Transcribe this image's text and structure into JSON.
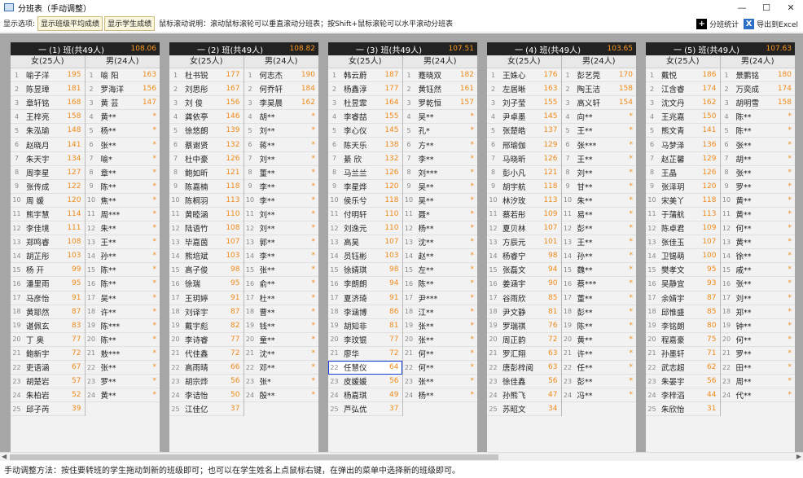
{
  "window": {
    "title": "分班表（手动调整）",
    "min": "—",
    "max": "☐",
    "close": "✕"
  },
  "toolbar": {
    "label": "显示选项:",
    "btn_avg": "显示班级平均成绩",
    "btn_score": "显示学生成绩",
    "note": "鼠标滚动说明：滚动鼠标滚轮可以垂直滚动分班表；按Shift+鼠标滚轮可以水平滚动分班表",
    "stats": "分班统计",
    "export": "导出到Excel"
  },
  "status": "手动调整方法：按住要转班的学生拖动到新的班级即可；也可以在学生姓名上点鼠标右键，在弹出的菜单中选择新的班级即可。",
  "classes": [
    {
      "title": "一 (1) 班(共49人)",
      "avg": "108.06",
      "female_hdr": "女(25人)",
      "male_hdr": "男(24人)",
      "female": [
        [
          "1",
          "喻子洋",
          "195"
        ],
        [
          "2",
          "陈昱璋",
          "181"
        ],
        [
          "3",
          "章轩铭",
          "168"
        ],
        [
          "4",
          "王梓亮",
          "158"
        ],
        [
          "5",
          "朱泓瑜",
          "148"
        ],
        [
          "6",
          "赵晓月",
          "141"
        ],
        [
          "7",
          "朱天宇",
          "134"
        ],
        [
          "8",
          "周李星",
          "127"
        ],
        [
          "9",
          "张传成",
          "122"
        ],
        [
          "10",
          "周 媛",
          "120"
        ],
        [
          "11",
          "熊宇慧",
          "114"
        ],
        [
          "12",
          "李佳境",
          "111"
        ],
        [
          "13",
          "郑鸣睿",
          "108"
        ],
        [
          "14",
          "胡芷彤",
          "103"
        ],
        [
          "15",
          "杨 开",
          "99"
        ],
        [
          "16",
          "潘里雨",
          "95"
        ],
        [
          "17",
          "马彦怡",
          "91"
        ],
        [
          "18",
          "黄耶然",
          "87"
        ],
        [
          "19",
          "谌佩玄",
          "83"
        ],
        [
          "20",
          "丁 奥",
          "77"
        ],
        [
          "21",
          "鲍新宇",
          "72"
        ],
        [
          "22",
          "吏语涵",
          "67"
        ],
        [
          "23",
          "胡楚岩",
          "57"
        ],
        [
          "24",
          "朱柏岩",
          "52"
        ],
        [
          "25",
          "邱子芮",
          "39"
        ]
      ],
      "male": [
        [
          "1",
          "喻 阳",
          "163"
        ],
        [
          "2",
          "罗海洋",
          "156"
        ],
        [
          "3",
          "黄 芸",
          "147"
        ],
        [
          "4",
          "黄**",
          "*"
        ],
        [
          "5",
          "杨**",
          "*"
        ],
        [
          "6",
          "张**",
          "*"
        ],
        [
          "7",
          "喻*",
          "*"
        ],
        [
          "8",
          "章**",
          "*"
        ],
        [
          "9",
          "陈**",
          "*"
        ],
        [
          "10",
          "焦**",
          "*"
        ],
        [
          "11",
          "周***",
          "*"
        ],
        [
          "12",
          "朱**",
          "*"
        ],
        [
          "13",
          "王**",
          "*"
        ],
        [
          "14",
          "孙**",
          "*"
        ],
        [
          "15",
          "陈**",
          "*"
        ],
        [
          "16",
          "陈**",
          "*"
        ],
        [
          "17",
          "吴**",
          "*"
        ],
        [
          "18",
          "许**",
          "*"
        ],
        [
          "19",
          "陈***",
          "*"
        ],
        [
          "20",
          "陈**",
          "*"
        ],
        [
          "21",
          "敖***",
          "*"
        ],
        [
          "22",
          "张**",
          "*"
        ],
        [
          "23",
          "罗**",
          "*"
        ],
        [
          "24",
          "黄**",
          "*"
        ]
      ]
    },
    {
      "title": "一 (2) 班(共49人)",
      "avg": "108.82",
      "female_hdr": "女(25人)",
      "male_hdr": "男(24人)",
      "female": [
        [
          "1",
          "杜书锐",
          "177"
        ],
        [
          "2",
          "刘思彤",
          "167"
        ],
        [
          "3",
          "刘 俊",
          "156"
        ],
        [
          "4",
          "龚依亭",
          "146"
        ],
        [
          "5",
          "徐悠朗",
          "139"
        ],
        [
          "6",
          "蔡谢贤",
          "132"
        ],
        [
          "7",
          "杜中豪",
          "126"
        ],
        [
          "8",
          "鲍如昕",
          "121"
        ],
        [
          "9",
          "陈嘉楠",
          "118"
        ],
        [
          "10",
          "陈桐羽",
          "113"
        ],
        [
          "11",
          "黄睦涵",
          "110"
        ],
        [
          "12",
          "陆语竹",
          "108"
        ],
        [
          "13",
          "毕嘉茵",
          "107"
        ],
        [
          "14",
          "熊培斌",
          "103"
        ],
        [
          "15",
          "高子俊",
          "98"
        ],
        [
          "16",
          "徐瑞",
          "95"
        ],
        [
          "17",
          "王玥婷",
          "91"
        ],
        [
          "18",
          "刘译宇",
          "87"
        ],
        [
          "19",
          "戴宇彪",
          "82"
        ],
        [
          "20",
          "李诗睿",
          "77"
        ],
        [
          "21",
          "代佳鑫",
          "72"
        ],
        [
          "22",
          "高雨晴",
          "66"
        ],
        [
          "23",
          "胡宗烨",
          "56"
        ],
        [
          "24",
          "李诘怡",
          "50"
        ],
        [
          "25",
          "江佳亿",
          "37"
        ]
      ],
      "male": [
        [
          "1",
          "何志杰",
          "190"
        ],
        [
          "2",
          "何乔轩",
          "184"
        ],
        [
          "3",
          "李昊晨",
          "162"
        ],
        [
          "4",
          "胡**",
          "*"
        ],
        [
          "5",
          "刘**",
          "*"
        ],
        [
          "6",
          "蒋**",
          "*"
        ],
        [
          "7",
          "刘**",
          "*"
        ],
        [
          "8",
          "董**",
          "*"
        ],
        [
          "9",
          "李**",
          "*"
        ],
        [
          "10",
          "李**",
          "*"
        ],
        [
          "11",
          "刘**",
          "*"
        ],
        [
          "12",
          "刘**",
          "*"
        ],
        [
          "13",
          "郭**",
          "*"
        ],
        [
          "14",
          "李**",
          "*"
        ],
        [
          "15",
          "张**",
          "*"
        ],
        [
          "16",
          "俞**",
          "*"
        ],
        [
          "17",
          "杜**",
          "*"
        ],
        [
          "18",
          "曹**",
          "*"
        ],
        [
          "19",
          "钱**",
          "*"
        ],
        [
          "20",
          "童**",
          "*"
        ],
        [
          "21",
          "沈**",
          "*"
        ],
        [
          "22",
          "邓**",
          "*"
        ],
        [
          "23",
          "张*",
          "*"
        ],
        [
          "24",
          "殷**",
          "*"
        ]
      ]
    },
    {
      "title": "一 (3) 班(共49人)",
      "avg": "107.51",
      "female_hdr": "女(25人)",
      "male_hdr": "男(24人)",
      "female": [
        [
          "1",
          "韩云蔚",
          "187"
        ],
        [
          "2",
          "杨鑫淳",
          "177"
        ],
        [
          "3",
          "杜昱霏",
          "164"
        ],
        [
          "4",
          "李睿喆",
          "155"
        ],
        [
          "5",
          "李心仪",
          "145"
        ],
        [
          "6",
          "陈天乐",
          "138"
        ],
        [
          "7",
          "綦 欣",
          "132"
        ],
        [
          "8",
          "马兰兰",
          "126"
        ],
        [
          "9",
          "李星烨",
          "120"
        ],
        [
          "10",
          "侯乐兮",
          "118"
        ],
        [
          "11",
          "付明轩",
          "110"
        ],
        [
          "12",
          "刘逸元",
          "110"
        ],
        [
          "13",
          "高昊",
          "107"
        ],
        [
          "14",
          "员钰彬",
          "103"
        ],
        [
          "15",
          "徐婧琪",
          "98"
        ],
        [
          "16",
          "李朗朗",
          "94"
        ],
        [
          "17",
          "夏济琦",
          "91"
        ],
        [
          "18",
          "李涵博",
          "86"
        ],
        [
          "19",
          "胡知非",
          "81"
        ],
        [
          "20",
          "李玟锟",
          "77"
        ],
        [
          "21",
          "廖华",
          "72"
        ],
        [
          "22",
          "任慧仪",
          "64"
        ],
        [
          "23",
          "皮媛媛",
          "56"
        ],
        [
          "24",
          "杨嘉琪",
          "49"
        ],
        [
          "25",
          "芦弘优",
          "37"
        ]
      ],
      "male": [
        [
          "1",
          "蹇晓双",
          "182"
        ],
        [
          "2",
          "黄钰然",
          "161"
        ],
        [
          "3",
          "罗乾恒",
          "157"
        ],
        [
          "4",
          "吴**",
          "*"
        ],
        [
          "5",
          "孔*",
          "*"
        ],
        [
          "6",
          "方**",
          "*"
        ],
        [
          "7",
          "李**",
          "*"
        ],
        [
          "8",
          "刘***",
          "*"
        ],
        [
          "9",
          "吴**",
          "*"
        ],
        [
          "10",
          "吴**",
          "*"
        ],
        [
          "11",
          "聂*",
          "*"
        ],
        [
          "12",
          "杨**",
          "*"
        ],
        [
          "13",
          "沈**",
          "*"
        ],
        [
          "14",
          "赵**",
          "*"
        ],
        [
          "15",
          "左**",
          "*"
        ],
        [
          "16",
          "陈**",
          "*"
        ],
        [
          "17",
          "尹***",
          "*"
        ],
        [
          "18",
          "江**",
          "*"
        ],
        [
          "19",
          "张**",
          "*"
        ],
        [
          "20",
          "张**",
          "*"
        ],
        [
          "21",
          "何**",
          "*"
        ],
        [
          "22",
          "何**",
          "*"
        ],
        [
          "23",
          "张**",
          "*"
        ],
        [
          "24",
          "杨**",
          "*"
        ]
      ]
    },
    {
      "title": "一 (4) 班(共49人)",
      "avg": "103.65",
      "female_hdr": "女(25人)",
      "male_hdr": "男(24人)",
      "female": [
        [
          "1",
          "王姝心",
          "176"
        ],
        [
          "2",
          "左居晰",
          "163"
        ],
        [
          "3",
          "刘子莹",
          "155"
        ],
        [
          "4",
          "尹卓墨",
          "145"
        ],
        [
          "5",
          "张楚皓",
          "137"
        ],
        [
          "6",
          "邢瑜伽",
          "129"
        ],
        [
          "7",
          "马晓昕",
          "126"
        ],
        [
          "8",
          "彭小凡",
          "121"
        ],
        [
          "9",
          "胡宇航",
          "118"
        ],
        [
          "10",
          "林汐玫",
          "113"
        ],
        [
          "11",
          "蔡若彤",
          "109"
        ],
        [
          "12",
          "夏贝林",
          "107"
        ],
        [
          "13",
          "方辰元",
          "101"
        ],
        [
          "14",
          "杨睿宁",
          "98"
        ],
        [
          "15",
          "张磊文",
          "94"
        ],
        [
          "16",
          "姜涵宇",
          "90"
        ],
        [
          "17",
          "谷雨欣",
          "85"
        ],
        [
          "18",
          "尹文静",
          "81"
        ],
        [
          "19",
          "罗瑞祺",
          "76"
        ],
        [
          "20",
          "周正韵",
          "72"
        ],
        [
          "21",
          "罗汇翔",
          "63"
        ],
        [
          "22",
          "唐彭梓阅",
          "63"
        ],
        [
          "23",
          "徐佳鑫",
          "56"
        ],
        [
          "24",
          "孙熊飞",
          "47"
        ],
        [
          "25",
          "苏昭文",
          "34"
        ]
      ],
      "male": [
        [
          "1",
          "彭艺莞",
          "170"
        ],
        [
          "2",
          "陶王洁",
          "158"
        ],
        [
          "3",
          "高义轩",
          "154"
        ],
        [
          "4",
          "向**",
          "*"
        ],
        [
          "5",
          "王**",
          "*"
        ],
        [
          "6",
          "张***",
          "*"
        ],
        [
          "7",
          "王**",
          "*"
        ],
        [
          "8",
          "刘**",
          "*"
        ],
        [
          "9",
          "甘**",
          "*"
        ],
        [
          "10",
          "朱**",
          "*"
        ],
        [
          "11",
          "易**",
          "*"
        ],
        [
          "12",
          "彭**",
          "*"
        ],
        [
          "13",
          "王**",
          "*"
        ],
        [
          "14",
          "孙**",
          "*"
        ],
        [
          "15",
          "魏**",
          "*"
        ],
        [
          "16",
          "蔡***",
          "*"
        ],
        [
          "17",
          "董**",
          "*"
        ],
        [
          "18",
          "彭**",
          "*"
        ],
        [
          "19",
          "陈**",
          "*"
        ],
        [
          "20",
          "黄**",
          "*"
        ],
        [
          "21",
          "许**",
          "*"
        ],
        [
          "22",
          "任**",
          "*"
        ],
        [
          "23",
          "彭**",
          "*"
        ],
        [
          "24",
          "冯**",
          "*"
        ]
      ]
    },
    {
      "title": "一 (5) 班(共49人)",
      "avg": "107.63",
      "female_hdr": "女(25人)",
      "male_hdr": "男(24人)",
      "female": [
        [
          "1",
          "戴悦",
          "186"
        ],
        [
          "2",
          "江含睿",
          "174"
        ],
        [
          "3",
          "沈文丹",
          "162"
        ],
        [
          "4",
          "王兆嘉",
          "150"
        ],
        [
          "5",
          "熊文青",
          "141"
        ],
        [
          "6",
          "马梦泽",
          "136"
        ],
        [
          "7",
          "赵芷馨",
          "129"
        ],
        [
          "8",
          "王晶",
          "126"
        ],
        [
          "9",
          "张泽玥",
          "120"
        ],
        [
          "10",
          "宋美丫",
          "118"
        ],
        [
          "11",
          "于蒲航",
          "113"
        ],
        [
          "12",
          "陈卓君",
          "109"
        ],
        [
          "13",
          "张佳玉",
          "107"
        ],
        [
          "14",
          "卫锡萌",
          "100"
        ],
        [
          "15",
          "樊孝文",
          "95"
        ],
        [
          "16",
          "吴静宜",
          "93"
        ],
        [
          "17",
          "余婧宇",
          "87"
        ],
        [
          "18",
          "邱惟盛",
          "85"
        ],
        [
          "19",
          "李铭朗",
          "80"
        ],
        [
          "20",
          "程嘉豪",
          "75"
        ],
        [
          "21",
          "孙墨轩",
          "71"
        ],
        [
          "22",
          "武志超",
          "62"
        ],
        [
          "23",
          "朱晏宇",
          "56"
        ],
        [
          "24",
          "李梓滔",
          "44"
        ],
        [
          "25",
          "朱欣怡",
          "31"
        ]
      ],
      "male": [
        [
          "1",
          "景鹏铭",
          "180"
        ],
        [
          "2",
          "万奕成",
          "174"
        ],
        [
          "3",
          "胡明雪",
          "158"
        ],
        [
          "4",
          "陈**",
          "*"
        ],
        [
          "5",
          "陈**",
          "*"
        ],
        [
          "6",
          "张**",
          "*"
        ],
        [
          "7",
          "胡**",
          "*"
        ],
        [
          "8",
          "张**",
          "*"
        ],
        [
          "9",
          "罗**",
          "*"
        ],
        [
          "10",
          "黄**",
          "*"
        ],
        [
          "11",
          "黄**",
          "*"
        ],
        [
          "12",
          "何**",
          "*"
        ],
        [
          "13",
          "黄**",
          "*"
        ],
        [
          "14",
          "徐**",
          "*"
        ],
        [
          "15",
          "戚**",
          "*"
        ],
        [
          "16",
          "张**",
          "*"
        ],
        [
          "17",
          "刘**",
          "*"
        ],
        [
          "18",
          "郑**",
          "*"
        ],
        [
          "19",
          "钟**",
          "*"
        ],
        [
          "20",
          "何**",
          "*"
        ],
        [
          "21",
          "罗**",
          "*"
        ],
        [
          "22",
          "田**",
          "*"
        ],
        [
          "23",
          "周**",
          "*"
        ],
        [
          "24",
          "代**",
          "*"
        ]
      ]
    }
  ],
  "highlight": {
    "class": 2,
    "gender": "female",
    "row": 21
  }
}
